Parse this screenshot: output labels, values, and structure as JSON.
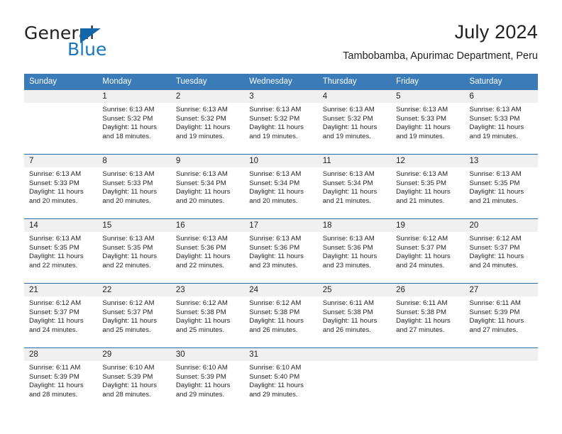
{
  "logo": {
    "primary_text": "General",
    "secondary_text": "Blue",
    "triangle_icon": "logo-triangle-icon",
    "primary_color": "#231f20",
    "secondary_color": "#1878be",
    "triangle_color": "#1267ab"
  },
  "header": {
    "title": "July 2024",
    "subtitle": "Tambobamba, Apurimac Department, Peru"
  },
  "theme": {
    "header_bg": "#3b7cb8",
    "row_separator": "#2e6da4",
    "daynum_band_bg": "#f0f0f0",
    "text_color": "#231f20"
  },
  "calendar": {
    "weekday_headers": [
      "Sunday",
      "Monday",
      "Tuesday",
      "Wednesday",
      "Thursday",
      "Friday",
      "Saturday"
    ],
    "weeks": [
      [
        {
          "day": "",
          "sunrise": "",
          "sunset": "",
          "daylight_line1": "",
          "daylight_line2": "",
          "empty": true
        },
        {
          "day": "1",
          "sunrise": "Sunrise: 6:13 AM",
          "sunset": "Sunset: 5:32 PM",
          "daylight_line1": "Daylight: 11 hours",
          "daylight_line2": "and 18 minutes."
        },
        {
          "day": "2",
          "sunrise": "Sunrise: 6:13 AM",
          "sunset": "Sunset: 5:32 PM",
          "daylight_line1": "Daylight: 11 hours",
          "daylight_line2": "and 19 minutes."
        },
        {
          "day": "3",
          "sunrise": "Sunrise: 6:13 AM",
          "sunset": "Sunset: 5:32 PM",
          "daylight_line1": "Daylight: 11 hours",
          "daylight_line2": "and 19 minutes."
        },
        {
          "day": "4",
          "sunrise": "Sunrise: 6:13 AM",
          "sunset": "Sunset: 5:32 PM",
          "daylight_line1": "Daylight: 11 hours",
          "daylight_line2": "and 19 minutes."
        },
        {
          "day": "5",
          "sunrise": "Sunrise: 6:13 AM",
          "sunset": "Sunset: 5:33 PM",
          "daylight_line1": "Daylight: 11 hours",
          "daylight_line2": "and 19 minutes."
        },
        {
          "day": "6",
          "sunrise": "Sunrise: 6:13 AM",
          "sunset": "Sunset: 5:33 PM",
          "daylight_line1": "Daylight: 11 hours",
          "daylight_line2": "and 19 minutes."
        }
      ],
      [
        {
          "day": "7",
          "sunrise": "Sunrise: 6:13 AM",
          "sunset": "Sunset: 5:33 PM",
          "daylight_line1": "Daylight: 11 hours",
          "daylight_line2": "and 20 minutes."
        },
        {
          "day": "8",
          "sunrise": "Sunrise: 6:13 AM",
          "sunset": "Sunset: 5:33 PM",
          "daylight_line1": "Daylight: 11 hours",
          "daylight_line2": "and 20 minutes."
        },
        {
          "day": "9",
          "sunrise": "Sunrise: 6:13 AM",
          "sunset": "Sunset: 5:34 PM",
          "daylight_line1": "Daylight: 11 hours",
          "daylight_line2": "and 20 minutes."
        },
        {
          "day": "10",
          "sunrise": "Sunrise: 6:13 AM",
          "sunset": "Sunset: 5:34 PM",
          "daylight_line1": "Daylight: 11 hours",
          "daylight_line2": "and 20 minutes."
        },
        {
          "day": "11",
          "sunrise": "Sunrise: 6:13 AM",
          "sunset": "Sunset: 5:34 PM",
          "daylight_line1": "Daylight: 11 hours",
          "daylight_line2": "and 21 minutes."
        },
        {
          "day": "12",
          "sunrise": "Sunrise: 6:13 AM",
          "sunset": "Sunset: 5:35 PM",
          "daylight_line1": "Daylight: 11 hours",
          "daylight_line2": "and 21 minutes."
        },
        {
          "day": "13",
          "sunrise": "Sunrise: 6:13 AM",
          "sunset": "Sunset: 5:35 PM",
          "daylight_line1": "Daylight: 11 hours",
          "daylight_line2": "and 21 minutes."
        }
      ],
      [
        {
          "day": "14",
          "sunrise": "Sunrise: 6:13 AM",
          "sunset": "Sunset: 5:35 PM",
          "daylight_line1": "Daylight: 11 hours",
          "daylight_line2": "and 22 minutes."
        },
        {
          "day": "15",
          "sunrise": "Sunrise: 6:13 AM",
          "sunset": "Sunset: 5:35 PM",
          "daylight_line1": "Daylight: 11 hours",
          "daylight_line2": "and 22 minutes."
        },
        {
          "day": "16",
          "sunrise": "Sunrise: 6:13 AM",
          "sunset": "Sunset: 5:36 PM",
          "daylight_line1": "Daylight: 11 hours",
          "daylight_line2": "and 22 minutes."
        },
        {
          "day": "17",
          "sunrise": "Sunrise: 6:13 AM",
          "sunset": "Sunset: 5:36 PM",
          "daylight_line1": "Daylight: 11 hours",
          "daylight_line2": "and 23 minutes."
        },
        {
          "day": "18",
          "sunrise": "Sunrise: 6:13 AM",
          "sunset": "Sunset: 5:36 PM",
          "daylight_line1": "Daylight: 11 hours",
          "daylight_line2": "and 23 minutes."
        },
        {
          "day": "19",
          "sunrise": "Sunrise: 6:12 AM",
          "sunset": "Sunset: 5:37 PM",
          "daylight_line1": "Daylight: 11 hours",
          "daylight_line2": "and 24 minutes."
        },
        {
          "day": "20",
          "sunrise": "Sunrise: 6:12 AM",
          "sunset": "Sunset: 5:37 PM",
          "daylight_line1": "Daylight: 11 hours",
          "daylight_line2": "and 24 minutes."
        }
      ],
      [
        {
          "day": "21",
          "sunrise": "Sunrise: 6:12 AM",
          "sunset": "Sunset: 5:37 PM",
          "daylight_line1": "Daylight: 11 hours",
          "daylight_line2": "and 24 minutes."
        },
        {
          "day": "22",
          "sunrise": "Sunrise: 6:12 AM",
          "sunset": "Sunset: 5:37 PM",
          "daylight_line1": "Daylight: 11 hours",
          "daylight_line2": "and 25 minutes."
        },
        {
          "day": "23",
          "sunrise": "Sunrise: 6:12 AM",
          "sunset": "Sunset: 5:38 PM",
          "daylight_line1": "Daylight: 11 hours",
          "daylight_line2": "and 25 minutes."
        },
        {
          "day": "24",
          "sunrise": "Sunrise: 6:12 AM",
          "sunset": "Sunset: 5:38 PM",
          "daylight_line1": "Daylight: 11 hours",
          "daylight_line2": "and 26 minutes."
        },
        {
          "day": "25",
          "sunrise": "Sunrise: 6:11 AM",
          "sunset": "Sunset: 5:38 PM",
          "daylight_line1": "Daylight: 11 hours",
          "daylight_line2": "and 26 minutes."
        },
        {
          "day": "26",
          "sunrise": "Sunrise: 6:11 AM",
          "sunset": "Sunset: 5:38 PM",
          "daylight_line1": "Daylight: 11 hours",
          "daylight_line2": "and 27 minutes."
        },
        {
          "day": "27",
          "sunrise": "Sunrise: 6:11 AM",
          "sunset": "Sunset: 5:39 PM",
          "daylight_line1": "Daylight: 11 hours",
          "daylight_line2": "and 27 minutes."
        }
      ],
      [
        {
          "day": "28",
          "sunrise": "Sunrise: 6:11 AM",
          "sunset": "Sunset: 5:39 PM",
          "daylight_line1": "Daylight: 11 hours",
          "daylight_line2": "and 28 minutes."
        },
        {
          "day": "29",
          "sunrise": "Sunrise: 6:10 AM",
          "sunset": "Sunset: 5:39 PM",
          "daylight_line1": "Daylight: 11 hours",
          "daylight_line2": "and 28 minutes."
        },
        {
          "day": "30",
          "sunrise": "Sunrise: 6:10 AM",
          "sunset": "Sunset: 5:39 PM",
          "daylight_line1": "Daylight: 11 hours",
          "daylight_line2": "and 29 minutes."
        },
        {
          "day": "31",
          "sunrise": "Sunrise: 6:10 AM",
          "sunset": "Sunset: 5:40 PM",
          "daylight_line1": "Daylight: 11 hours",
          "daylight_line2": "and 29 minutes."
        },
        {
          "day": "",
          "sunrise": "",
          "sunset": "",
          "daylight_line1": "",
          "daylight_line2": "",
          "empty": true
        },
        {
          "day": "",
          "sunrise": "",
          "sunset": "",
          "daylight_line1": "",
          "daylight_line2": "",
          "empty": true
        },
        {
          "day": "",
          "sunrise": "",
          "sunset": "",
          "daylight_line1": "",
          "daylight_line2": "",
          "empty": true
        }
      ]
    ]
  }
}
